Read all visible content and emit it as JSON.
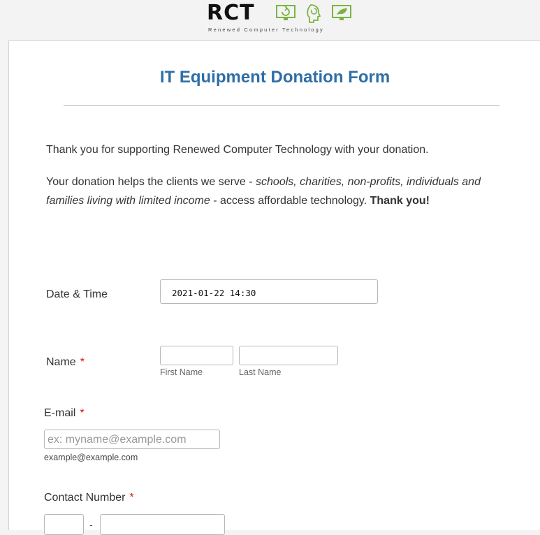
{
  "logo": {
    "wordmark": "RCT",
    "tagline": "Renewed Computer Technology",
    "icons": [
      "monitor-recycle-icon",
      "head-recycle-icon",
      "monitor-leaf-icon"
    ],
    "accent_color": "#7cb342"
  },
  "form": {
    "title": "IT Equipment Donation Form",
    "intro": "Thank you for supporting Renewed Computer Technology with your donation.",
    "body": {
      "lead": "Your donation helps the clients we serve - ",
      "clients": "schools, charities, non-profits, individuals and families living with limited income",
      "mid": " -  access affordable technology. ",
      "thanks": "Thank you!"
    },
    "fields": {
      "datetime": {
        "label": "Date & Time",
        "value": "2021-01-22 14:30"
      },
      "name": {
        "label": "Name",
        "required": "*",
        "first_sublabel": "First Name",
        "last_sublabel": "Last Name"
      },
      "email": {
        "label": "E-mail",
        "required": "*",
        "placeholder": "ex: myname@example.com",
        "hint": "example@example.com"
      },
      "contact": {
        "label": "Contact Number",
        "required": "*",
        "separator": "-"
      }
    }
  },
  "colors": {
    "title": "#2e6ea6",
    "required": "#dd1111"
  }
}
